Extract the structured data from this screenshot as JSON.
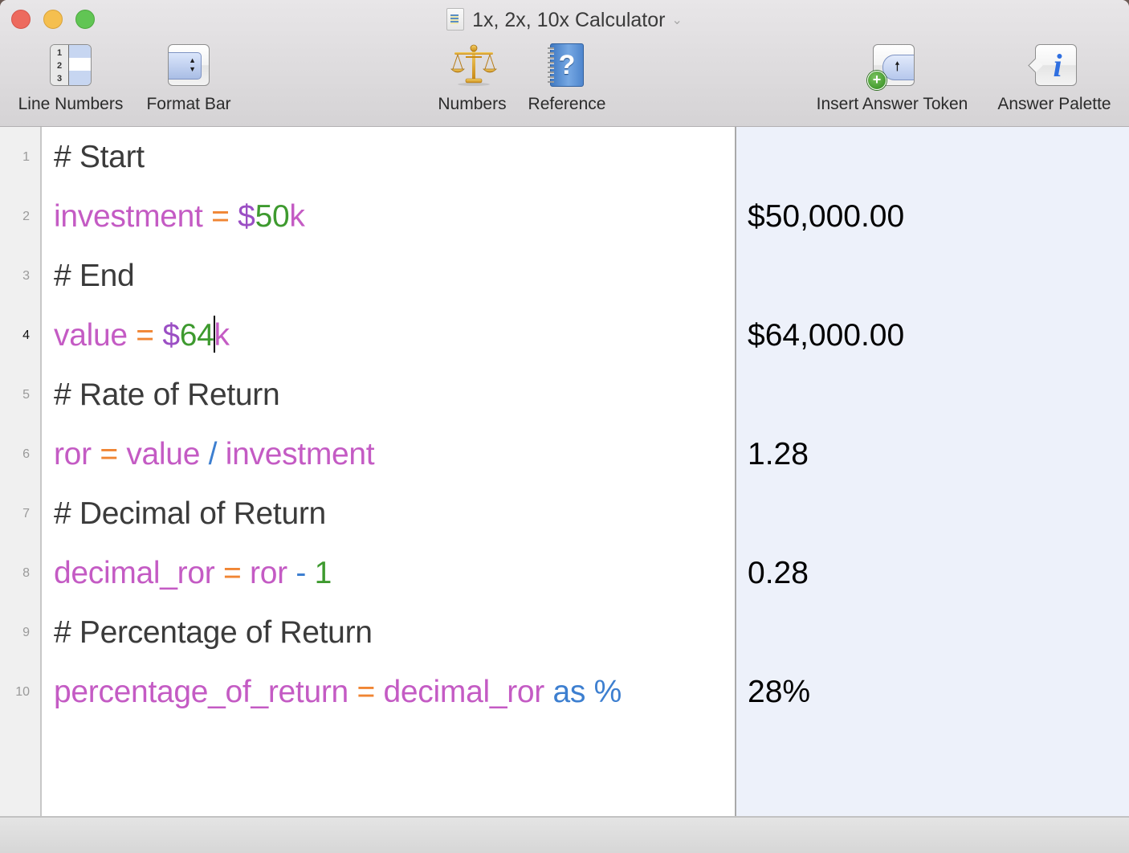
{
  "window": {
    "title": "1x, 2x, 10x Calculator",
    "title_icon": "document-icon",
    "title_menu_icon": "chevron-down-icon"
  },
  "toolbar": {
    "line_numbers": {
      "label": "Line Numbers",
      "icon": "line-numbers-icon"
    },
    "format_bar": {
      "label": "Format Bar",
      "icon": "popup-button-icon"
    },
    "numbers": {
      "label": "Numbers",
      "icon": "scales-icon"
    },
    "reference": {
      "label": "Reference",
      "icon": "help-book-icon"
    },
    "insert_answer_token": {
      "label": "Insert Answer Token",
      "icon": "token-insert-icon"
    },
    "answer_palette": {
      "label": "Answer Palette",
      "icon": "info-icon"
    }
  },
  "colors": {
    "comment": "#3b3b3b",
    "variable": "#c45bc4",
    "operator": "#f08533",
    "currency": "#9b4fc4",
    "number": "#3e9a2f",
    "keyword": "#3d7fd0",
    "answer_pane_bg": "#edf1fa"
  },
  "editor": {
    "current_line": 4,
    "lines": [
      {
        "number": "1",
        "tokens": [
          {
            "t": "# Start",
            "k": "comment"
          }
        ]
      },
      {
        "number": "2",
        "tokens": [
          {
            "t": "investment",
            "k": "variable"
          },
          {
            "t": " "
          },
          {
            "t": "=",
            "k": "operator"
          },
          {
            "t": " "
          },
          {
            "t": "$",
            "k": "currency"
          },
          {
            "t": "50",
            "k": "number"
          },
          {
            "t": "k",
            "k": "variable"
          }
        ]
      },
      {
        "number": "3",
        "tokens": [
          {
            "t": "# End",
            "k": "comment"
          }
        ]
      },
      {
        "number": "4",
        "tokens": [
          {
            "t": "value",
            "k": "variable"
          },
          {
            "t": " "
          },
          {
            "t": "=",
            "k": "operator"
          },
          {
            "t": " "
          },
          {
            "t": "$",
            "k": "currency"
          },
          {
            "t": "64",
            "k": "number"
          },
          {
            "caret": true
          },
          {
            "t": "k",
            "k": "variable"
          }
        ]
      },
      {
        "number": "5",
        "tokens": [
          {
            "t": "# Rate of Return",
            "k": "comment"
          }
        ]
      },
      {
        "number": "6",
        "tokens": [
          {
            "t": "ror",
            "k": "variable"
          },
          {
            "t": " "
          },
          {
            "t": "=",
            "k": "operator"
          },
          {
            "t": " "
          },
          {
            "t": "value",
            "k": "variable"
          },
          {
            "t": " "
          },
          {
            "t": "/",
            "k": "keyword"
          },
          {
            "t": " "
          },
          {
            "t": "investment",
            "k": "variable"
          }
        ]
      },
      {
        "number": "7",
        "tokens": [
          {
            "t": "# Decimal of Return",
            "k": "comment"
          }
        ]
      },
      {
        "number": "8",
        "tokens": [
          {
            "t": "decimal_ror",
            "k": "variable"
          },
          {
            "t": " "
          },
          {
            "t": "=",
            "k": "operator"
          },
          {
            "t": " "
          },
          {
            "t": "ror",
            "k": "variable"
          },
          {
            "t": " "
          },
          {
            "t": "-",
            "k": "keyword"
          },
          {
            "t": " "
          },
          {
            "t": "1",
            "k": "number"
          }
        ]
      },
      {
        "number": "9",
        "tokens": [
          {
            "t": "# Percentage of Return",
            "k": "comment"
          }
        ]
      },
      {
        "number": "10",
        "tokens": [
          {
            "t": "percentage_of_return",
            "k": "variable"
          },
          {
            "t": " "
          },
          {
            "t": "=",
            "k": "operator"
          },
          {
            "t": " "
          },
          {
            "t": "decimal_ror",
            "k": "variable"
          },
          {
            "t": " "
          },
          {
            "t": "as",
            "k": "keyword"
          },
          {
            "t": " "
          },
          {
            "t": "%",
            "k": "keyword"
          }
        ]
      }
    ]
  },
  "answers": [
    {
      "line": 2,
      "value": "$50,000.00"
    },
    {
      "line": 4,
      "value": "$64,000.00"
    },
    {
      "line": 6,
      "value": "1.28"
    },
    {
      "line": 8,
      "value": "0.28"
    },
    {
      "line": 10,
      "value": "28%"
    }
  ]
}
